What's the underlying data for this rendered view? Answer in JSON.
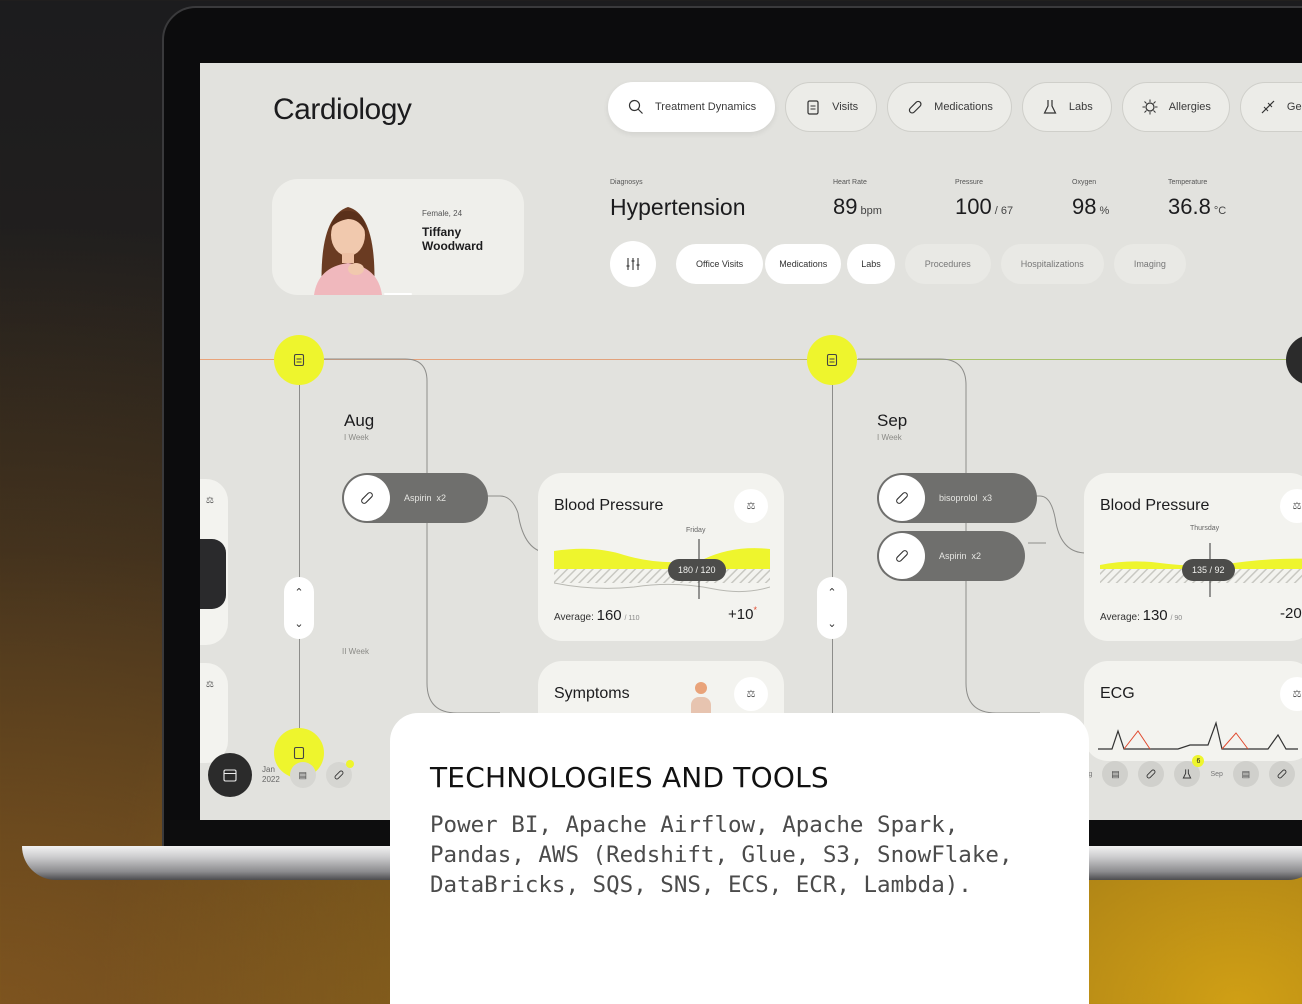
{
  "app": {
    "title": "Cardiology"
  },
  "tabs": [
    {
      "label": "Treatment Dynamics",
      "icon": "search-icon"
    },
    {
      "label": "Visits",
      "icon": "clipboard-icon"
    },
    {
      "label": "Medications",
      "icon": "pill-icon"
    },
    {
      "label": "Labs",
      "icon": "flask-icon"
    },
    {
      "label": "Allergies",
      "icon": "virus-icon"
    },
    {
      "label": "Genet",
      "icon": "dna-icon"
    }
  ],
  "patient": {
    "meta": "Female, 24",
    "first_name": "Tiffany",
    "last_name": "Woodward"
  },
  "diagnosis": {
    "label": "Diagnosys",
    "value": "Hypertension"
  },
  "vitals": {
    "heart_rate": {
      "label": "Heart Rate",
      "value": "89",
      "unit": "bpm"
    },
    "pressure": {
      "label": "Pressure",
      "value": "100",
      "unit": "/ 67"
    },
    "oxygen": {
      "label": "Oxygen",
      "value": "98",
      "unit": "%"
    },
    "temperature": {
      "label": "Temperature",
      "value": "36.8",
      "unit": "°C"
    }
  },
  "filters": [
    "Office Visits",
    "Medications",
    "Labs",
    "Procedures",
    "Hospitalizations",
    "Imaging"
  ],
  "timeline": {
    "aug": {
      "month": "Aug",
      "week1": "I Week",
      "week2": "II Week"
    },
    "sep": {
      "month": "Sep",
      "week1": "I Week"
    }
  },
  "medications": {
    "aug": [
      {
        "name": "Aspirin",
        "count": "x2"
      }
    ],
    "sep": [
      {
        "name": "bisoprolol",
        "count": "x3"
      },
      {
        "name": "Aspirin",
        "count": "x2"
      }
    ]
  },
  "bp_cards": {
    "aug": {
      "title": "Blood Pressure",
      "day": "Friday",
      "reading": "180 / 120",
      "avg_label": "Average:",
      "avg_value": "160",
      "avg_sub": "/ 110",
      "delta": "+10",
      "delta_mark": "*"
    },
    "sep": {
      "title": "Blood Pressure",
      "day": "Thursday",
      "reading": "135 / 92",
      "avg_label": "Average:",
      "avg_value": "130",
      "avg_sub": "/ 90",
      "delta": "-20"
    }
  },
  "symptoms_card": {
    "title": "Symptoms"
  },
  "ecg_card": {
    "title": "ECG"
  },
  "dock": {
    "month": "Jan",
    "year": "2022",
    "right_labels": [
      "Aug",
      "Sep"
    ],
    "badge": "6"
  },
  "overlay": {
    "title": "TECHNOLOGIES AND TOOLS",
    "text": "Power BI, Apache Airflow, Apache Spark, Pandas, AWS (Redshift, Glue, S3, SnowFlake, DataBricks, SQS, SNS, ECS, ECR, Lambda)."
  },
  "colors": {
    "accent": "#eef52d",
    "background": "#e2e2de",
    "card": "#f3f3ef",
    "pill": "#6f6f6d",
    "alert": "#e04a2f"
  }
}
